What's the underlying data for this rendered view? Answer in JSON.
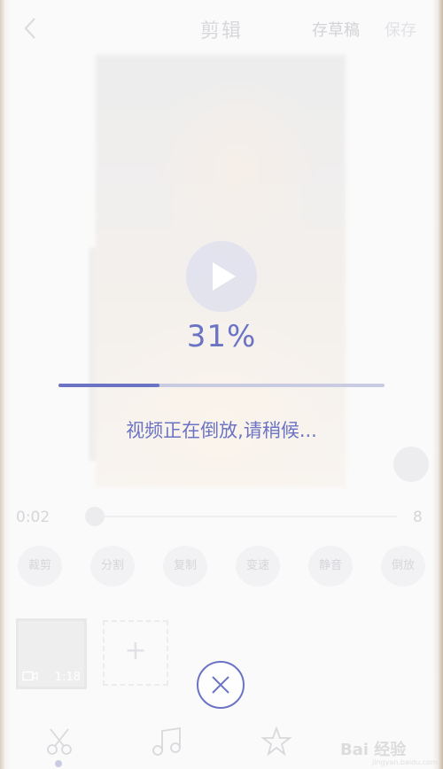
{
  "header": {
    "title": "剪辑",
    "draft_label": "存草稿",
    "save_label": "保存"
  },
  "processing": {
    "percent_label": "31%",
    "progress": 0.31,
    "status": "视频正在倒放,请稍候..."
  },
  "timeline": {
    "current_time": "0:02",
    "end_time_partial": "8"
  },
  "tools": [
    "裁剪",
    "分割",
    "复制",
    "变速",
    "静音",
    "倒放"
  ],
  "clips": [
    {
      "duration": "1:18"
    }
  ],
  "add_clip_symbol": "+",
  "bottom_nav": [
    "scissors-icon",
    "music-note-icon",
    "star-effects-icon"
  ],
  "watermark": {
    "text": "Bai 经验",
    "sub": "jingyan.baidu.com"
  },
  "colors": {
    "accent": "#6b73c4",
    "track": "#c9cbe3"
  }
}
